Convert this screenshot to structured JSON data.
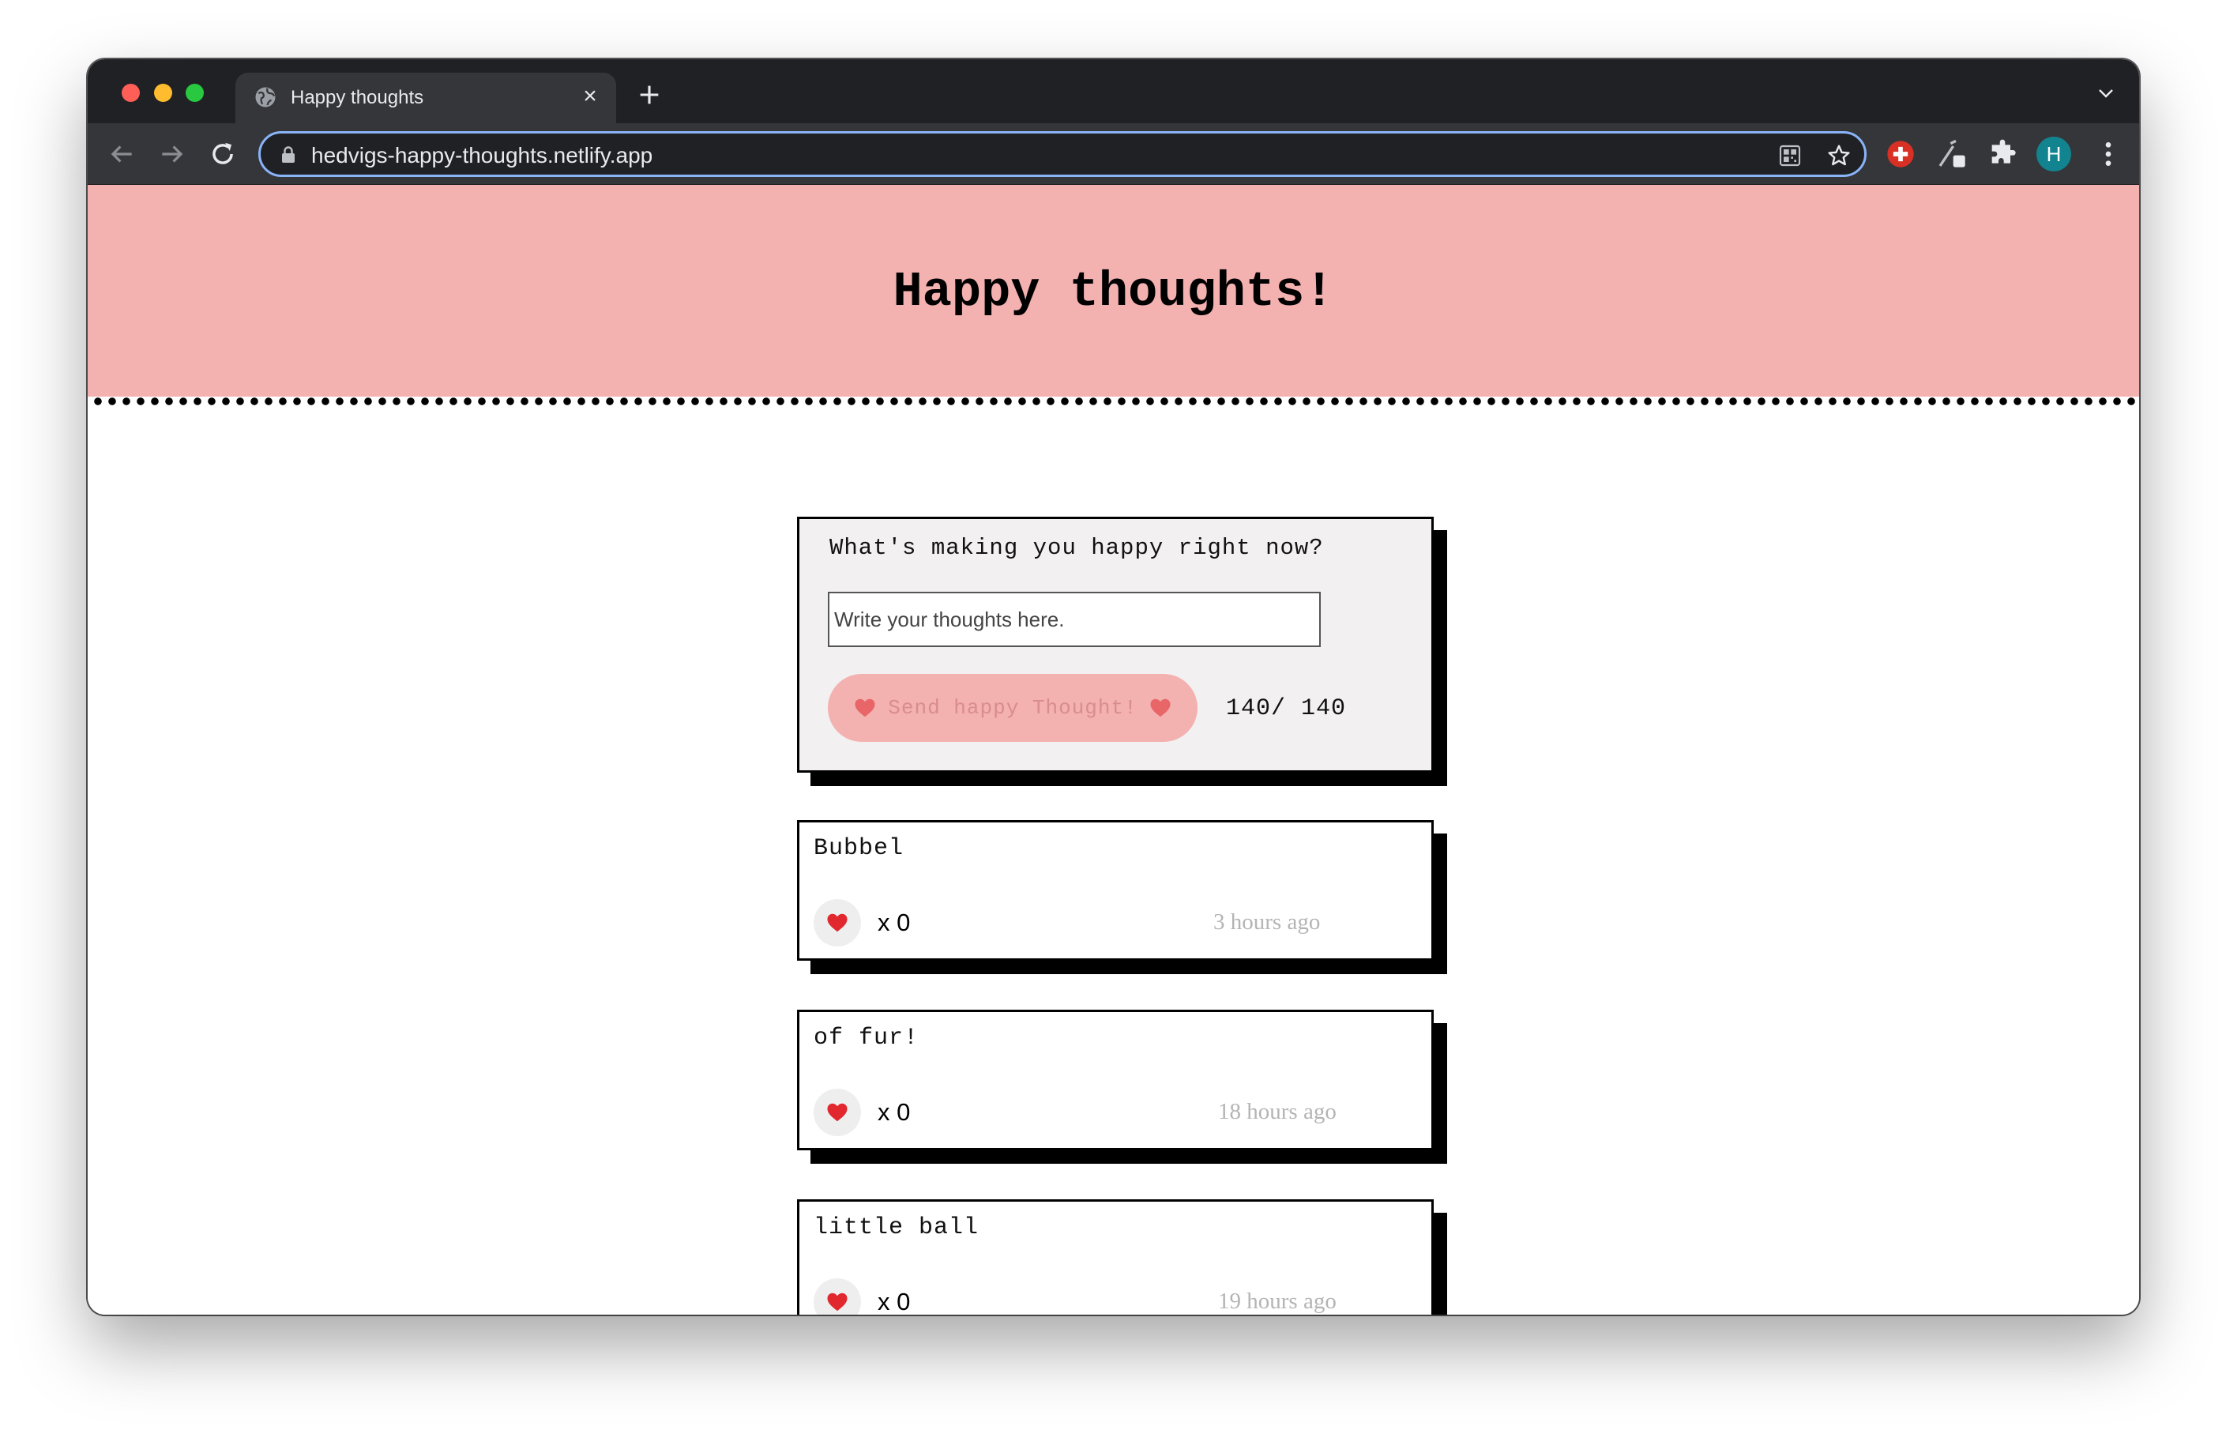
{
  "browser": {
    "tab_title": "Happy thoughts",
    "tab_close_glyph": "×",
    "url": "hedvigs-happy-thoughts.netlify.app",
    "profile_initial": "H",
    "icons": [
      "globe-icon",
      "close-icon",
      "plus-icon",
      "chevron-down-icon",
      "back-arrow-icon",
      "forward-arrow-icon",
      "reload-icon",
      "lock-icon",
      "qr-code-icon",
      "star-icon",
      "red-cross-extension-icon",
      "pen-extension-icon",
      "puzzle-extension-icon",
      "more-vert-icon"
    ],
    "colors": {
      "frame": "#202124",
      "toolbar": "#35363a",
      "omnibox_focus": "#8ab4f8",
      "avatar": "#12848f"
    }
  },
  "header": {
    "title": "Happy thoughts!",
    "background": "#f3b1b0"
  },
  "form": {
    "prompt": "What's making you happy right now?",
    "input_value": "",
    "input_placeholder": "Write your thoughts here.",
    "send_label": "Send happy Thought!",
    "char_count": "140/ 140",
    "icon": "heart-icon"
  },
  "thoughts": [
    {
      "text": "Bubbel",
      "likes": "x 0",
      "time": "3 hours ago"
    },
    {
      "text": "of fur!",
      "likes": "x 0",
      "time": "18 hours ago"
    },
    {
      "text": "little ball",
      "likes": "x 0",
      "time": "19 hours ago"
    }
  ]
}
